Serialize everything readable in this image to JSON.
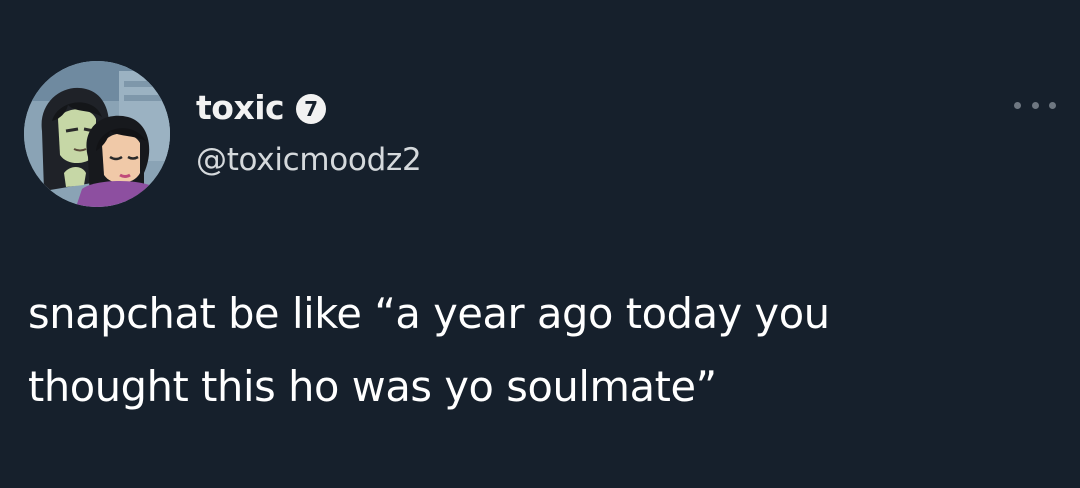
{
  "tweet": {
    "display_name": "toxic",
    "badge": "7",
    "handle": "@toxicmoodz2",
    "text": "snapchat be like “a year ago today you\nthought this ho was yo soulmate”"
  },
  "icons": {
    "avatar": "avatar-image",
    "more": "more-options-icon"
  },
  "colors": {
    "background": "#16202c",
    "text": "#ffffff",
    "secondary": "#d5d9dc"
  }
}
